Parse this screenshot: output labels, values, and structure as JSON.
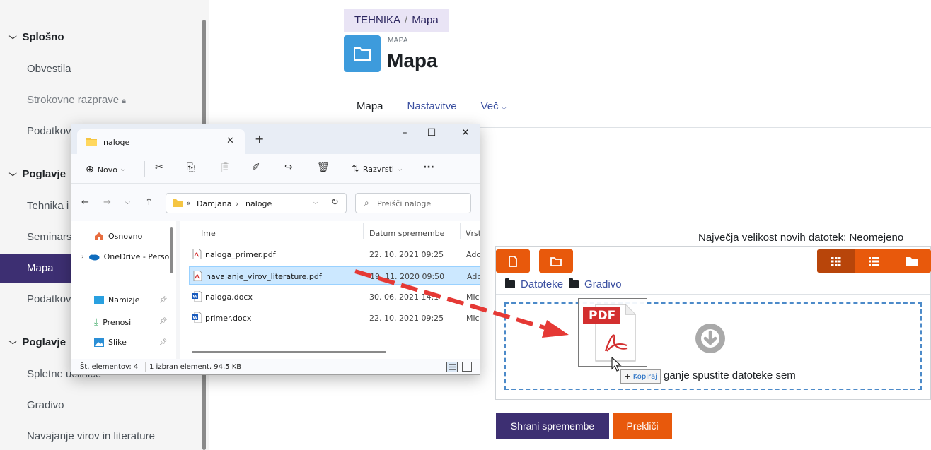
{
  "drawer": {
    "sections": [
      {
        "title": "Splošno",
        "items": [
          "Obvestila",
          "Strokovne razprave",
          "Podatkovna"
        ]
      },
      {
        "title": "Poglavje",
        "items": [
          "Tehnika i",
          "Seminarska",
          "Mapa",
          "Podatkovna"
        ]
      },
      {
        "title": "Poglavje",
        "items": [
          "Spletne učilnice",
          "Gradivo",
          "Navajanje virov in literature"
        ]
      }
    ],
    "active_item": "Mapa",
    "locked_item": "Strokovne razprave"
  },
  "page": {
    "breadcrumb": [
      "TEHNIKA",
      "Mapa"
    ],
    "module_type": "MAPA",
    "title": "Mapa",
    "tabs": [
      "Mapa",
      "Nastavitve",
      "Več"
    ]
  },
  "filepicker": {
    "max_size": "Največja velikost novih datotek: Neomejeno",
    "path": [
      "Datoteke",
      "Gradivo"
    ],
    "dropzone_text": "ganje spustite datoteke sem",
    "buttons": [
      "add-file",
      "create-folder"
    ],
    "views": [
      "icons",
      "list",
      "tree"
    ]
  },
  "actions": {
    "save": "Shrani spremembe",
    "cancel": "Prekliči"
  },
  "explorer": {
    "tab_title": "naloge",
    "new_label": "Novo",
    "sort_label": "Razvrsti",
    "address": [
      "Damjana",
      "naloge"
    ],
    "search_placeholder": "Preišči naloge",
    "nav_items": [
      {
        "label": "Osnovno",
        "icon": "home-icon"
      },
      {
        "label": "OneDrive - Perso",
        "icon": "onedrive-icon"
      },
      {
        "label": "Namizje",
        "icon": "desktop-icon"
      },
      {
        "label": "Prenosi",
        "icon": "download-icon"
      },
      {
        "label": "Slike",
        "icon": "pictures-icon"
      }
    ],
    "columns": [
      "Ime",
      "Datum spremembe",
      "Vrst"
    ],
    "files": [
      {
        "name": "naloga_primer.pdf",
        "date": "22. 10. 2021 09:25",
        "type": "Ado",
        "icon": "pdf-icon"
      },
      {
        "name": "navajanje_virov_literature.pdf",
        "date": "19. 11. 2020 09:50",
        "type": "Ado",
        "icon": "pdf-icon",
        "selected": true
      },
      {
        "name": "naloga.docx",
        "date": "30. 06. 2021 14:1",
        "type": "Mic",
        "icon": "word-icon"
      },
      {
        "name": "primer.docx",
        "date": "22. 10. 2021 09:25",
        "type": "Mic",
        "icon": "word-icon"
      }
    ],
    "status_count": "Št. elementov: 4",
    "status_selection": "1 izbran element, 94,5 KB"
  },
  "drag": {
    "ghost_label": "PDF",
    "tooltip_plus": "+",
    "tooltip_action": "Kopiraj"
  },
  "colors": {
    "moodle_purple": "#3d2f72",
    "orange": "#e8590c",
    "link_blue": "#3a4fa0",
    "folder_blue": "#3d9bdc",
    "drop_border": "#4c8ac9",
    "drag_arrow": "#e53935"
  }
}
